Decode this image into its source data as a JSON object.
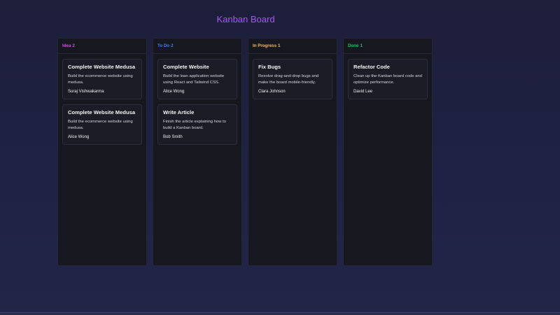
{
  "board": {
    "title": "Kanban Board"
  },
  "columns": [
    {
      "name": "Idea",
      "count": "2",
      "color": "#d946ef",
      "cards": [
        {
          "title": "Complete Website Medusa",
          "description": "Build the ecommerce website using medusa.",
          "assignee": "Suraj Vishwakarma"
        },
        {
          "title": "Complete Website Medusa",
          "description": "Build the ecommerce website using medusa.",
          "assignee": "Alice Wong"
        }
      ]
    },
    {
      "name": "To Do",
      "count": "2",
      "color": "#3b82f6",
      "cards": [
        {
          "title": "Complete Website",
          "description": "Build the loan application website using React and Tailwind CSS.",
          "assignee": "Alice Wong"
        },
        {
          "title": "Write Article",
          "description": "Finish the article explaining how to build a Kanban board.",
          "assignee": "Bob Smith"
        }
      ]
    },
    {
      "name": "In Progress",
      "count": "1",
      "color": "#f5b95f",
      "cards": [
        {
          "title": "Fix Bugs",
          "description": "Resolve drag-and-drop bugs and make the board mobile-friendly.",
          "assignee": "Clara Johnson"
        }
      ]
    },
    {
      "name": "Done",
      "count": "1",
      "color": "#22c55e",
      "cards": [
        {
          "title": "Refactor Code",
          "description": "Clean up the Kanban board code and optimize performance.",
          "assignee": "David Lee"
        }
      ]
    }
  ]
}
